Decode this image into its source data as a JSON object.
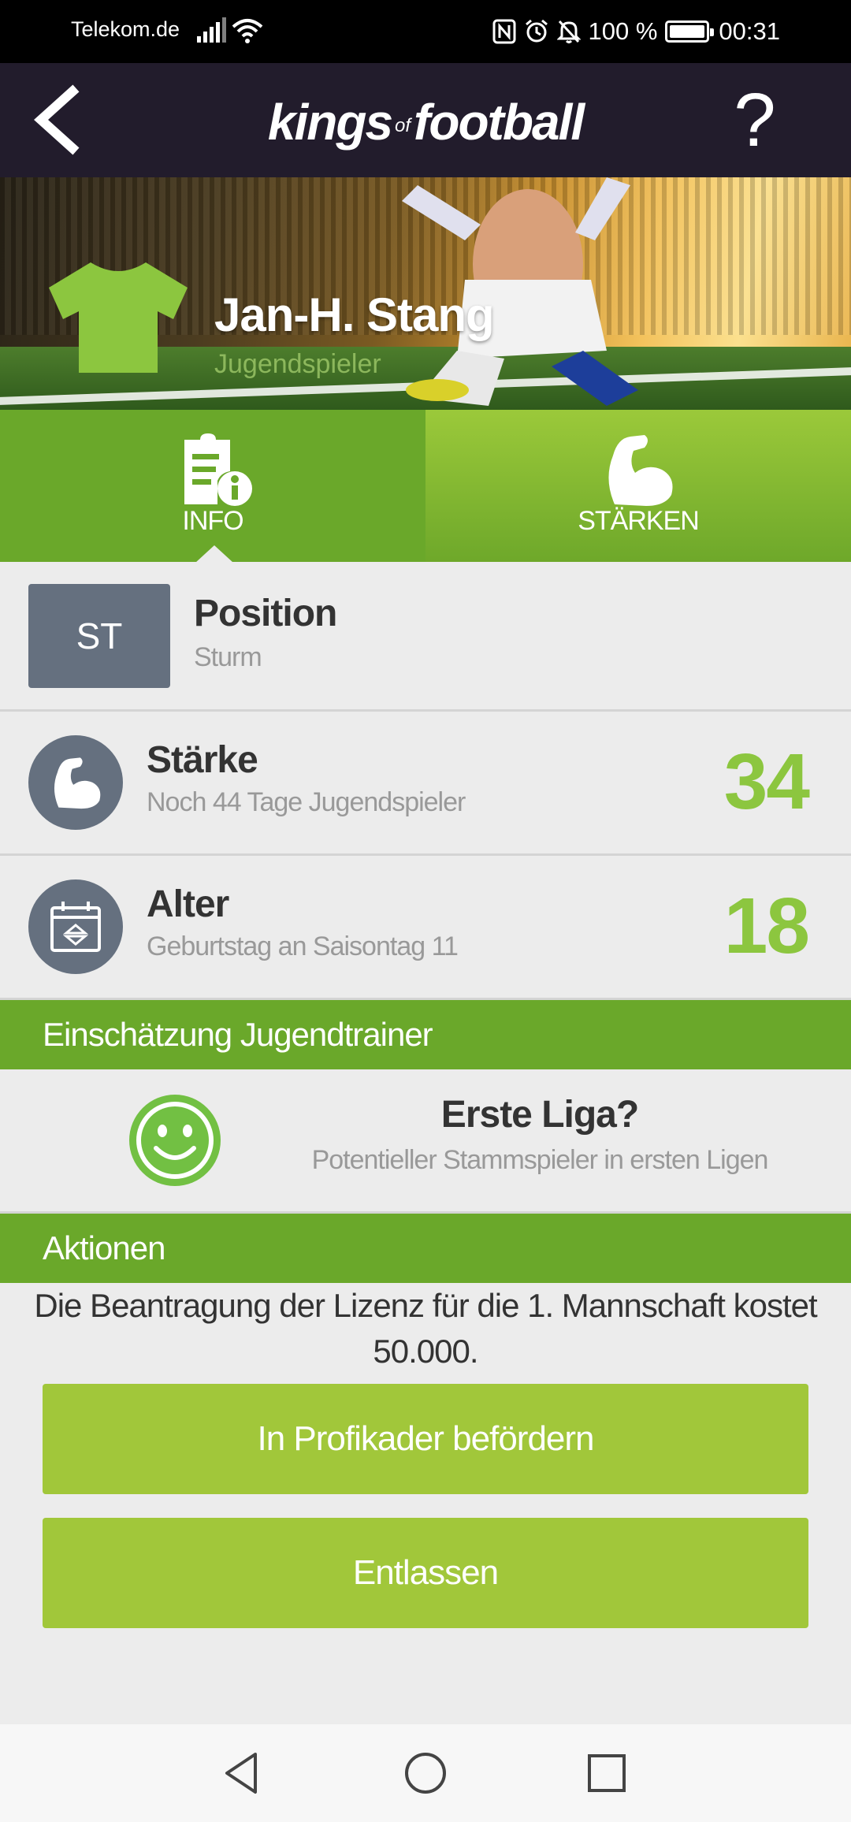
{
  "status_bar": {
    "carrier": "Telekom.de",
    "battery": "100 %",
    "time": "00:31"
  },
  "app_bar": {
    "logo_kings": "kings",
    "logo_of": "of",
    "logo_football": "football",
    "help_label": "?"
  },
  "player": {
    "name": "Jan-H. Stang",
    "role": "Jugendspieler",
    "jersey_color": "#8cc63f"
  },
  "tabs": [
    {
      "label": "INFO",
      "icon": "document-info-icon",
      "active": true
    },
    {
      "label": "STÄRKEN",
      "icon": "bicep-icon",
      "active": false
    }
  ],
  "info": {
    "position": {
      "badge": "ST",
      "title": "Position",
      "subtitle": "Sturm"
    },
    "strength": {
      "title": "Stärke",
      "subtitle": "Noch 44 Tage Jugendspieler",
      "value": "34"
    },
    "age": {
      "title": "Alter",
      "subtitle": "Geburtstag an Saisontag 11",
      "value": "18"
    }
  },
  "scout": {
    "header": "Einschätzung Jugendtrainer",
    "title": "Erste Liga?",
    "subtitle": "Potentieller Stammspieler in ersten Ligen",
    "icon": "smiley-icon"
  },
  "actions": {
    "header": "Aktionen",
    "text": "Die Beantragung der Lizenz für die 1. Mannschaft kostet 50.000.",
    "promote_label": "In Profikader befördern",
    "fire_label": "Entlassen"
  },
  "colors": {
    "accent_green": "#6aa82a",
    "button_green": "#a1c73a",
    "value_green": "#8cc63f",
    "appbar": "#221c2c",
    "badge_gray": "#65707f"
  }
}
